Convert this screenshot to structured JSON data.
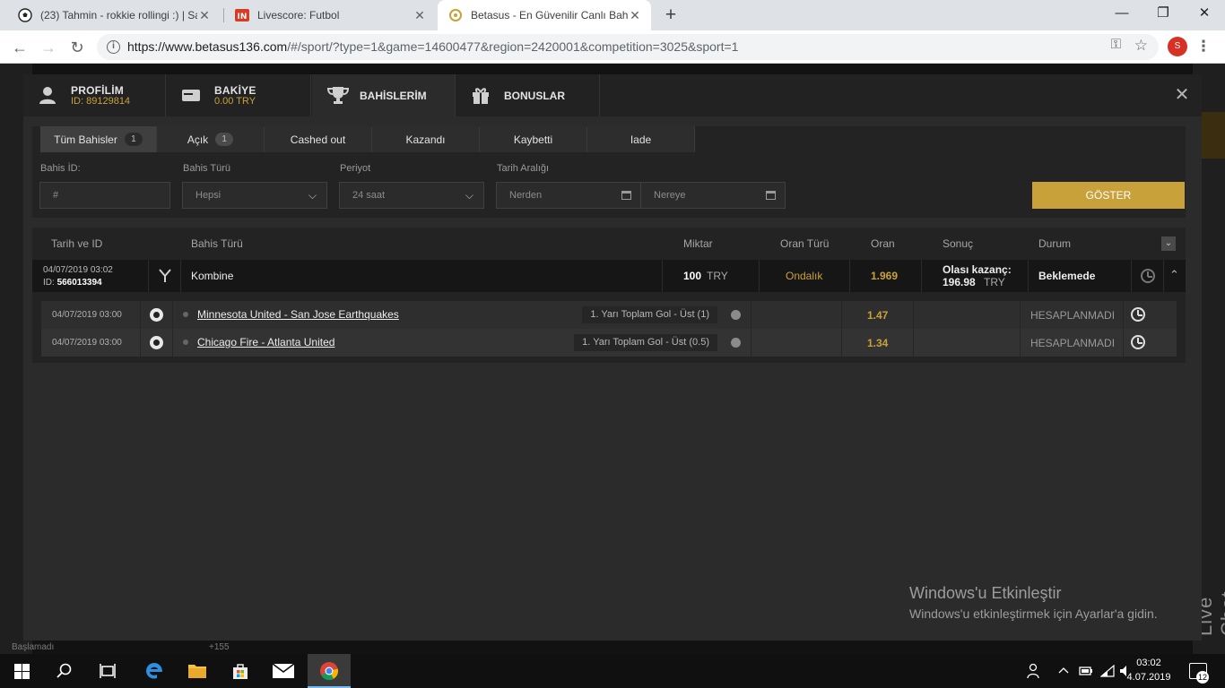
{
  "browser": {
    "tabs": [
      {
        "title": "(23) Tahmin - rokkie rollingi :) | Sa",
        "icon": "soccer-ball-icon"
      },
      {
        "title": "Livescore: Futbol",
        "icon": "livescore-icon"
      },
      {
        "title": "Betasus - En Güvenilir Canlı Bahis",
        "icon": "betasus-icon"
      }
    ],
    "url_host": "https://www.betasus136.com",
    "url_path": "/#/sport/?type=1&game=14600477&region=2420001&competition=3025&sport=1",
    "profile_initial": "S"
  },
  "background": {
    "left_texts": [
      "Başlamadı"
    ],
    "right_count": "+155",
    "live_chat": "Live Chat"
  },
  "modal": {
    "tabs": [
      {
        "title": "PROFİLİM",
        "sub": "ID: 89129814",
        "icon": "user-icon"
      },
      {
        "title": "BAKİYE",
        "sub": "0.00 TRY",
        "icon": "wallet-icon"
      },
      {
        "title": "BAHİSLERİM",
        "icon": "trophy-icon"
      },
      {
        "title": "BONUSLAR",
        "icon": "gift-icon"
      }
    ],
    "subtabs": [
      {
        "label": "Tüm Bahisler",
        "count": "1"
      },
      {
        "label": "Açık",
        "count": "1"
      },
      {
        "label": "Cashed out"
      },
      {
        "label": "Kazandı"
      },
      {
        "label": "Kaybetti"
      },
      {
        "label": "Iade"
      }
    ],
    "filters": {
      "bet_id_label": "Bahis İD:",
      "bet_id_placeholder": "#",
      "bet_type_label": "Bahis Türü",
      "bet_type_value": "Hepsi",
      "period_label": "Periyot",
      "period_value": "24 saat",
      "date_range_label": "Tarih Aralığı",
      "from_placeholder": "Nerden",
      "to_placeholder": "Nereye",
      "show_button": "GÖSTER"
    },
    "table": {
      "headers": [
        "Tarih ve ID",
        "Bahis Türü",
        "Miktar",
        "Oran Türü",
        "Oran",
        "Sonuç",
        "Durum"
      ],
      "bet": {
        "date": "04/07/2019 03:02",
        "id_label": "ID:",
        "id": "566013394",
        "type": "Kombine",
        "amount": "100",
        "currency": "TRY",
        "odd_type": "Ondalık",
        "odd": "1.969",
        "possible_win_label": "Olası kazanç:",
        "possible_win": "196.98",
        "possible_win_currency": "TRY",
        "status": "Beklemede"
      },
      "events": [
        {
          "date": "04/07/2019 03:00",
          "match": "Minnesota United - San Jose Earthquakes",
          "market": "1. Yarı Toplam Gol - Üst (1)",
          "odd": "1.47",
          "status": "HESAPLANMADI"
        },
        {
          "date": "04/07/2019 03:00",
          "match": "Chicago Fire - Atlanta United",
          "market": "1. Yarı Toplam Gol - Üst (0.5)",
          "odd": "1.34",
          "status": "HESAPLANMADI"
        }
      ]
    }
  },
  "watermark": {
    "title": "Windows'u Etkinleştir",
    "subtitle": "Windows'u etkinleştirmek için Ayarlar'a gidin."
  },
  "taskbar": {
    "time": "03:02",
    "date": "4.07.2019",
    "notifications": "12"
  },
  "colors": {
    "accent": "#c9a13a",
    "modal_bg": "#2b2b2b",
    "taskbar": "#101010"
  }
}
